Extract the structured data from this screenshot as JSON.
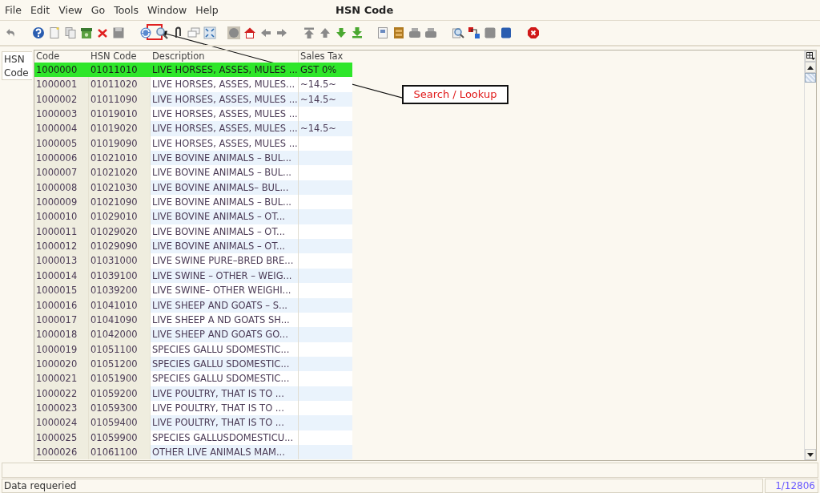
{
  "window": {
    "title": "HSN Code"
  },
  "menu": [
    "File",
    "Edit",
    "View",
    "Go",
    "Tools",
    "Window",
    "Help"
  ],
  "side_tab": {
    "label": "HSN Code",
    "selected": true
  },
  "table": {
    "columns": [
      "Code",
      "HSN Code",
      "Description",
      "Sales Tax"
    ],
    "rows": [
      {
        "cells": [
          "1000000",
          "01011010",
          "LIVE HORSES, ASSES, MULES ...",
          "GST 0%"
        ],
        "selected": true
      },
      {
        "cells": [
          "1000001",
          "01011020",
          "LIVE HORSES, ASSES, MULES...",
          "~14.5~"
        ],
        "selected": false
      },
      {
        "cells": [
          "1000002",
          "01011090",
          "LIVE HORSES, ASSES, MULES ...",
          "~14.5~"
        ],
        "selected": false
      },
      {
        "cells": [
          "1000003",
          "01019010",
          "LIVE HORSES, ASSES, MULES ...",
          ""
        ],
        "selected": false
      },
      {
        "cells": [
          "1000004",
          "01019020",
          "LIVE HORSES, ASSES, MULES ...",
          "~14.5~"
        ],
        "selected": false
      },
      {
        "cells": [
          "1000005",
          "01019090",
          "LIVE HORSES, ASSES, MULES ...",
          ""
        ],
        "selected": false
      },
      {
        "cells": [
          "1000006",
          "01021010",
          "LIVE BOVINE ANIMALS – BUL...",
          ""
        ],
        "selected": false
      },
      {
        "cells": [
          "1000007",
          "01021020",
          "LIVE BOVINE ANIMALS – BUL...",
          ""
        ],
        "selected": false
      },
      {
        "cells": [
          "1000008",
          "01021030",
          "LIVE BOVINE ANIMALS– BUL...",
          ""
        ],
        "selected": false
      },
      {
        "cells": [
          "1000009",
          "01021090",
          "LIVE BOVINE ANIMALS – BUL...",
          ""
        ],
        "selected": false
      },
      {
        "cells": [
          "1000010",
          "01029010",
          "LIVE BOVINE ANIMALS – OT...",
          ""
        ],
        "selected": false
      },
      {
        "cells": [
          "1000011",
          "01029020",
          "LIVE BOVINE ANIMALS – OT...",
          ""
        ],
        "selected": false
      },
      {
        "cells": [
          "1000012",
          "01029090",
          "LIVE BOVINE ANIMALS – OT...",
          ""
        ],
        "selected": false
      },
      {
        "cells": [
          "1000013",
          "01031000",
          "LIVE SWINE PURE–BRED BRE...",
          ""
        ],
        "selected": false
      },
      {
        "cells": [
          "1000014",
          "01039100",
          "LIVE SWINE – OTHER – WEIG...",
          ""
        ],
        "selected": false
      },
      {
        "cells": [
          "1000015",
          "01039200",
          "LIVE SWINE– OTHER WEIGHI...",
          ""
        ],
        "selected": false
      },
      {
        "cells": [
          "1000016",
          "01041010",
          "LIVE SHEEP AND GOATS – S...",
          ""
        ],
        "selected": false
      },
      {
        "cells": [
          "1000017",
          "01041090",
          "LIVE SHEEP A ND GOATS SH...",
          ""
        ],
        "selected": false
      },
      {
        "cells": [
          "1000018",
          "01042000",
          "LIVE SHEEP AND GOATS GO...",
          ""
        ],
        "selected": false
      },
      {
        "cells": [
          "1000019",
          "01051100",
          "SPECIES GALLU SDOMESTIC...",
          ""
        ],
        "selected": false
      },
      {
        "cells": [
          "1000020",
          "01051200",
          "SPECIES GALLU SDOMESTIC...",
          ""
        ],
        "selected": false
      },
      {
        "cells": [
          "1000021",
          "01051900",
          "SPECIES GALLU SDOMESTIC...",
          ""
        ],
        "selected": false
      },
      {
        "cells": [
          "1000022",
          "01059200",
          "LIVE POULTRY, THAT IS TO ...",
          ""
        ],
        "selected": false
      },
      {
        "cells": [
          "1000023",
          "01059300",
          "LIVE POULTRY, THAT IS TO ...",
          ""
        ],
        "selected": false
      },
      {
        "cells": [
          "1000024",
          "01059400",
          "LIVE POULTRY, THAT IS TO ...",
          ""
        ],
        "selected": false
      },
      {
        "cells": [
          "1000025",
          "01059900",
          "SPECIES GALLUSDOMESTICU...",
          ""
        ],
        "selected": false
      },
      {
        "cells": [
          "1000026",
          "01061100",
          "OTHER LIVE ANIMALS MAM...",
          ""
        ],
        "selected": false
      }
    ]
  },
  "callout": {
    "text": "Search / Lookup"
  },
  "status_bar": {
    "message": "Data requeried",
    "record": "1/12806"
  }
}
